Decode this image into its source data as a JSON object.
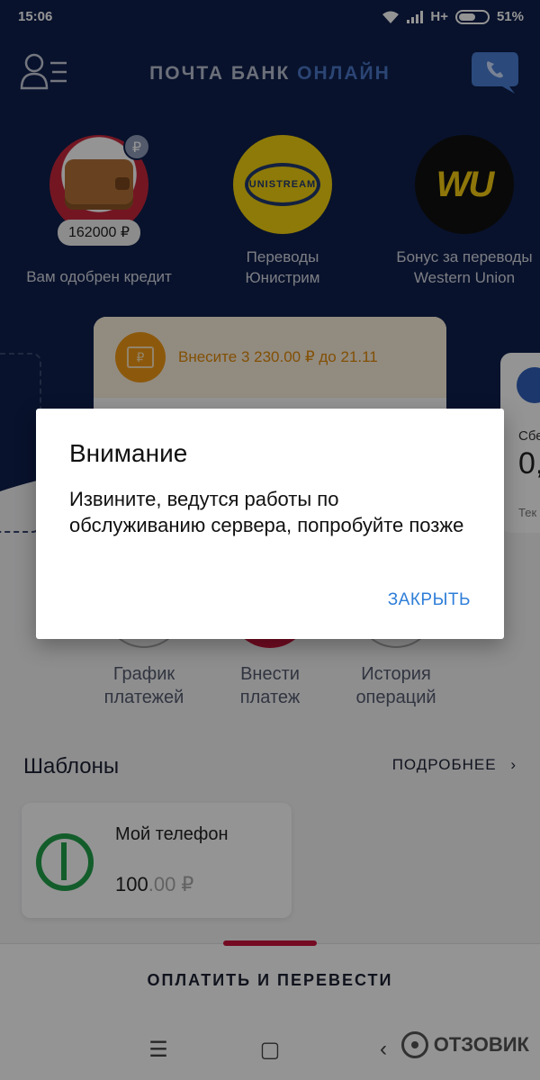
{
  "status_bar": {
    "time": "15:06",
    "network": "H+",
    "battery": "51%"
  },
  "header": {
    "title_main": "ПОЧТА БАНК",
    "title_accent": "ОНЛАЙН"
  },
  "promos": [
    {
      "label": "Вам одобрен кредит",
      "amount": "162000 ₽",
      "badge": "₽"
    },
    {
      "label_line1": "Переводы",
      "label_line2": "Юнистрим",
      "logo_text": "UNISTREAM"
    },
    {
      "label_line1": "Бонус за переводы",
      "label_line2": "Western Union",
      "logo_text": "WU"
    }
  ],
  "payment_card": {
    "banner": "Внесите 3 230.00 ₽ до 21.11",
    "badge": "₽"
  },
  "side_card": {
    "label": "Сбе",
    "value": "0,",
    "caption": "Тек"
  },
  "actions": [
    {
      "line1": "График",
      "line2": "платежей"
    },
    {
      "line1": "Внести",
      "line2": "платеж"
    },
    {
      "line1": "История",
      "line2": "операций"
    }
  ],
  "templates": {
    "title": "Шаблоны",
    "more": "ПОДРОБНЕЕ",
    "more_chevron": "›",
    "items": [
      {
        "name": "Мой телефон",
        "amount_int": "100",
        "amount_dec": ".00 ₽"
      }
    ]
  },
  "pay_bar": {
    "label": "ОПЛАТИТЬ И ПЕРЕВЕСТИ"
  },
  "nav": {
    "menu_glyph": "☰",
    "home_glyph": "▢",
    "back_glyph": "‹"
  },
  "watermark": {
    "text": "ОТЗОВИК"
  },
  "dialog": {
    "title": "Внимание",
    "message": "Извините, ведутся работы по обслуживанию сервера, попробуйте позже",
    "button": "ЗАКРЫТЬ"
  },
  "colors": {
    "brand_dark": "#0f1f4d",
    "accent_red": "#c8143b",
    "dialog_button": "#2f7ed8",
    "warning_orange": "#e08a0a"
  }
}
